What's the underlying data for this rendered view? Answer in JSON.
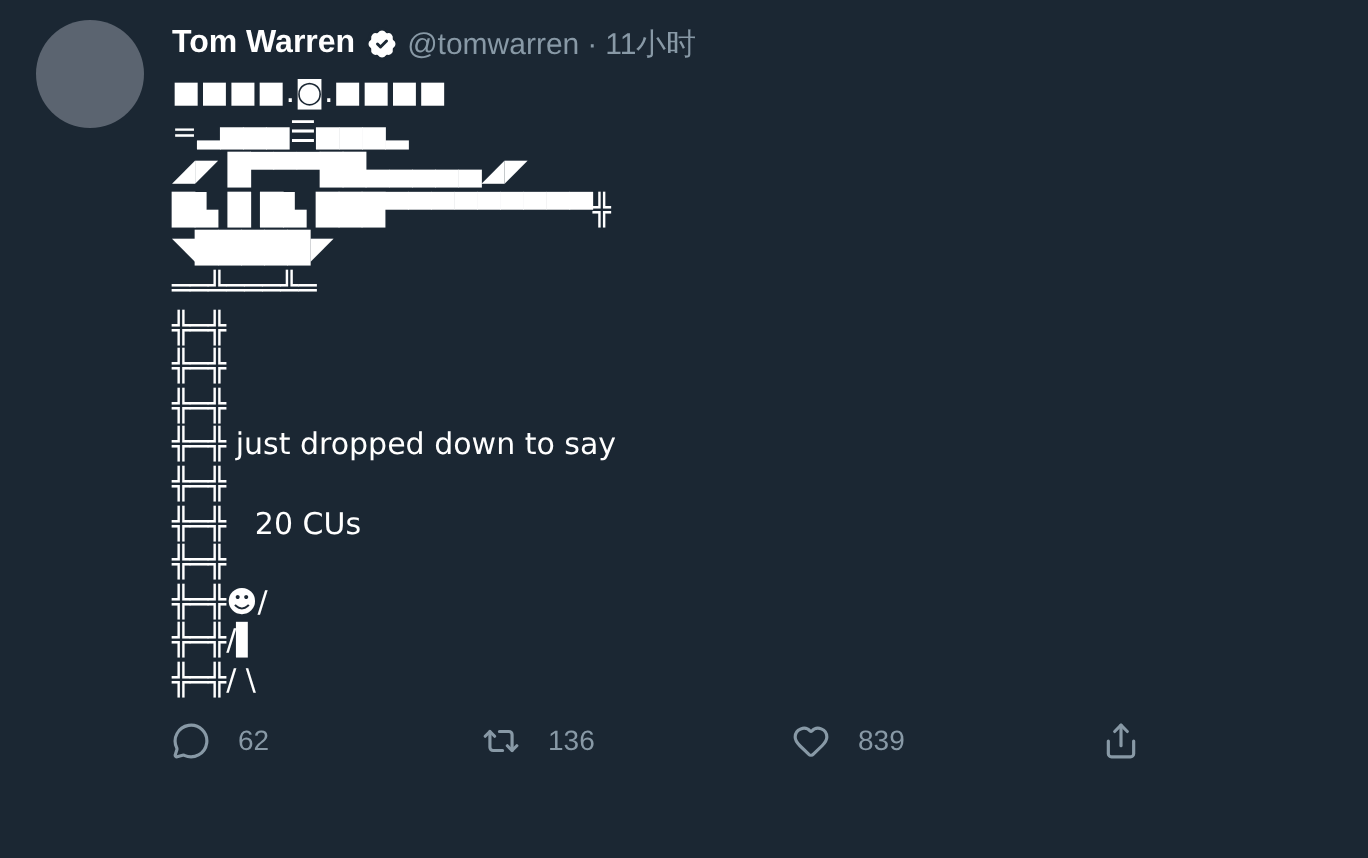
{
  "tweet": {
    "author": "Tom Warren",
    "handle": "@tomwarren",
    "separator": "·",
    "time": "11小时",
    "lines": [
      "■■■■.◙.■■■■",
      "=▂▅▅▅☰▅▅▅▂",
      "◢◤ █▀▀▀██▄▄▄▄▄◢◤",
      "█▙ █ █▙ ███▀▀▀▀▀▀▀▀▀╬",
      "◥█████◤",
      "══╩═══╩═",
      "╬═╬",
      "╬═╬",
      "╬═╬",
      "╬═╬ just dropped down to say",
      "╬═╬",
      "╬═╬   20 CUs",
      "╬═╬",
      "╬═╬☻/",
      "╬═╬/▌",
      "╬═╬/ \\"
    ],
    "actions": [
      {
        "kind": "reply",
        "count": "62"
      },
      {
        "kind": "retweet",
        "count": "136"
      },
      {
        "kind": "like",
        "count": "839"
      },
      {
        "kind": "share"
      }
    ]
  }
}
